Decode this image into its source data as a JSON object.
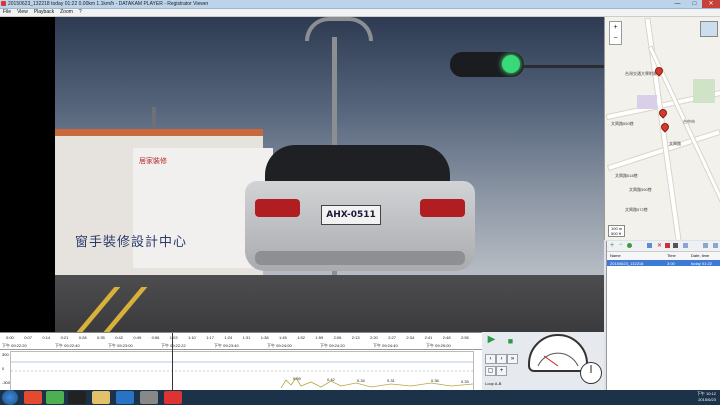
{
  "window": {
    "title": "20150623_132218 today 01:22 0.00km 1.1km/h - DATAKAM PLAYER - Registrator Viewer",
    "controls": {
      "minimize": "—",
      "maximize": "□",
      "close": "✕"
    }
  },
  "menu": {
    "items": [
      "File",
      "View",
      "Playback",
      "Zoom",
      "?"
    ]
  },
  "video": {
    "plate": "AHX-0511",
    "sign_text": "窗手裝修設計中心",
    "shop_text": "居家裝修"
  },
  "timeline": {
    "ticks": [
      "0:00",
      "0:07",
      "0:14",
      "0:21",
      "0:28",
      "0:35",
      "0:42",
      "0:49",
      "0:56",
      "1:03",
      "1:10",
      "1:17",
      "1:24",
      "1:31",
      "1:38",
      "1:45",
      "1:52",
      "1:59",
      "2:06",
      "2:13",
      "2:20",
      "2:27",
      "2:34",
      "2:41",
      "2:48",
      "2:55"
    ],
    "clock_labels": [
      "下午 09:22:20",
      "下午 09:22:40",
      "下午 09:23:00",
      "下午 09:22:22",
      "下午 09:23:40",
      "下午 09:24:00",
      "下午 09:24:20",
      "下午 09:24:40",
      "下午 09:25:00"
    ],
    "graph_left_labels": [
      "300",
      "0",
      "-300"
    ],
    "graph_values": [
      "0.59",
      "0.42",
      "0.34",
      "0.31",
      "0.36",
      "0.33"
    ],
    "cursor_label": "1:03"
  },
  "controls": {
    "play_icon": "▶",
    "stop_icon": "■",
    "loop_label": "Loop A-B"
  },
  "map": {
    "zoom_in": "+",
    "zoom_out": "−",
    "labels": [
      "台灣交通大學附屬",
      "文興路650巷",
      "文興路618巷",
      "文興路590巷",
      "文興路572巷",
      "文興路",
      "台中市"
    ],
    "scale": "100 m",
    "scale2": "500 ft"
  },
  "filelist": {
    "columns": [
      "Name",
      "Time",
      "Date, time"
    ],
    "rows": [
      {
        "name": "20150623_132218",
        "time": "3:00",
        "date": "today 01:22"
      }
    ]
  },
  "taskbar": {
    "clock_time": "下午 10:12",
    "clock_date": "2015/6/23"
  }
}
